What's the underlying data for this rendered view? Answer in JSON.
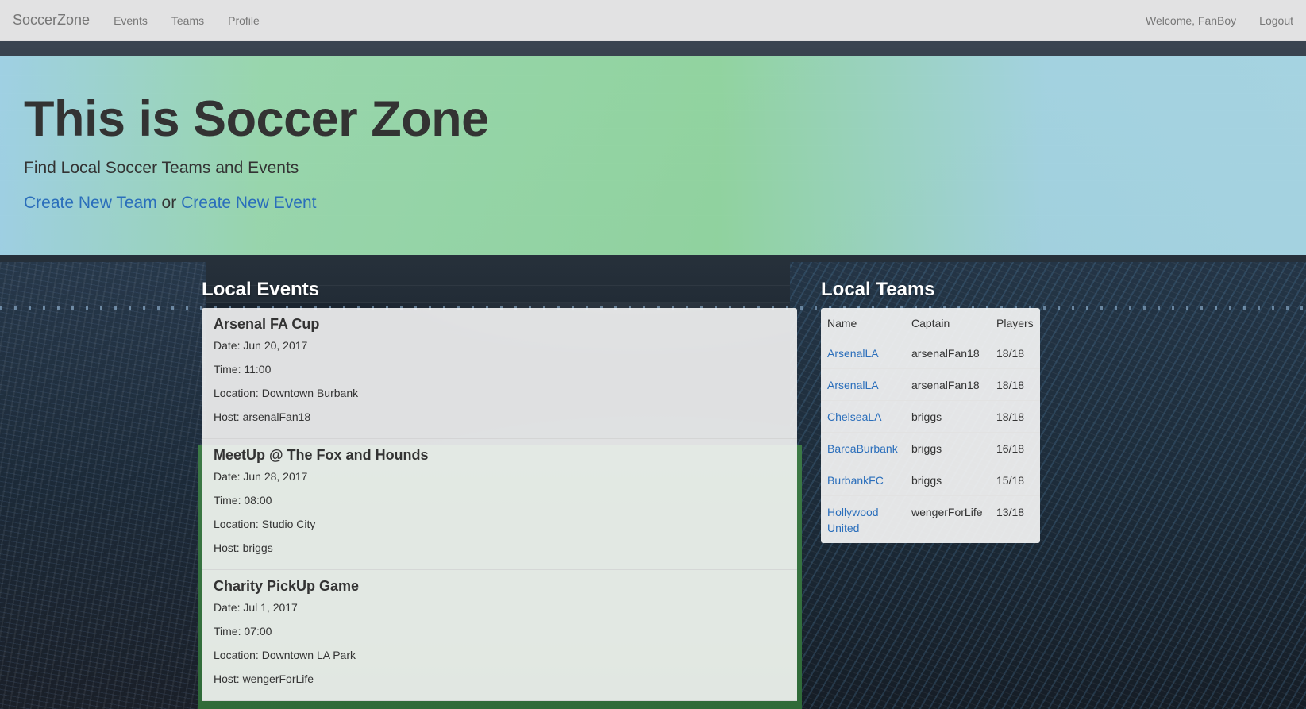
{
  "navbar": {
    "brand": "SoccerZone",
    "links": [
      "Events",
      "Teams",
      "Profile"
    ],
    "welcome": "Welcome, FanBoy",
    "logout": "Logout"
  },
  "jumbotron": {
    "title": "This is Soccer Zone",
    "subtitle": "Find Local Soccer Teams and Events",
    "create_team": "Create New Team",
    "or_text": "or",
    "create_event": "Create New Event"
  },
  "events": {
    "heading": "Local Events",
    "items": [
      {
        "name": "Arsenal FA Cup",
        "date": "Date: Jun 20, 2017",
        "time": "Time: 11:00",
        "location": "Location: Downtown Burbank",
        "host": "Host: arsenalFan18"
      },
      {
        "name": "MeetUp @ The Fox and Hounds",
        "date": "Date: Jun 28, 2017",
        "time": "Time: 08:00",
        "location": "Location: Studio City",
        "host": "Host: briggs"
      },
      {
        "name": "Charity PickUp Game",
        "date": "Date: Jul 1, 2017",
        "time": "Time: 07:00",
        "location": "Location: Downtown LA Park",
        "host": "Host: wengerForLife"
      }
    ]
  },
  "teams": {
    "heading": "Local Teams",
    "columns": [
      "Name",
      "Captain",
      "Players"
    ],
    "rows": [
      {
        "name": "ArsenalLA",
        "captain": "arsenalFan18",
        "players": "18/18"
      },
      {
        "name": "ArsenalLA",
        "captain": "arsenalFan18",
        "players": "18/18"
      },
      {
        "name": "ChelseaLA",
        "captain": "briggs",
        "players": "18/18"
      },
      {
        "name": "BarcaBurbank",
        "captain": "briggs",
        "players": "16/18"
      },
      {
        "name": "BurbankFC",
        "captain": "briggs",
        "players": "15/18"
      },
      {
        "name": "Hollywood United",
        "captain": "wengerForLife",
        "players": "13/18"
      }
    ]
  },
  "colors": {
    "link": "#2a6ebb",
    "nav_text": "#777777",
    "heading_white": "#ffffff"
  }
}
